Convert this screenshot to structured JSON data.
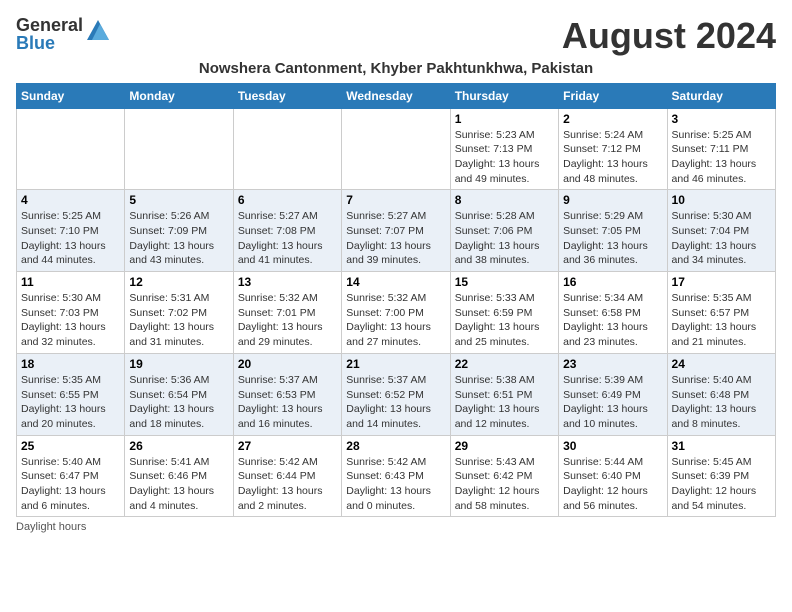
{
  "header": {
    "logo_general": "General",
    "logo_blue": "Blue",
    "month_title": "August 2024",
    "location": "Nowshera Cantonment, Khyber Pakhtunkhwa, Pakistan"
  },
  "weekdays": [
    "Sunday",
    "Monday",
    "Tuesday",
    "Wednesday",
    "Thursday",
    "Friday",
    "Saturday"
  ],
  "weeks": [
    [
      {
        "day": "",
        "info": ""
      },
      {
        "day": "",
        "info": ""
      },
      {
        "day": "",
        "info": ""
      },
      {
        "day": "",
        "info": ""
      },
      {
        "day": "1",
        "info": "Sunrise: 5:23 AM\nSunset: 7:13 PM\nDaylight: 13 hours\nand 49 minutes."
      },
      {
        "day": "2",
        "info": "Sunrise: 5:24 AM\nSunset: 7:12 PM\nDaylight: 13 hours\nand 48 minutes."
      },
      {
        "day": "3",
        "info": "Sunrise: 5:25 AM\nSunset: 7:11 PM\nDaylight: 13 hours\nand 46 minutes."
      }
    ],
    [
      {
        "day": "4",
        "info": "Sunrise: 5:25 AM\nSunset: 7:10 PM\nDaylight: 13 hours\nand 44 minutes."
      },
      {
        "day": "5",
        "info": "Sunrise: 5:26 AM\nSunset: 7:09 PM\nDaylight: 13 hours\nand 43 minutes."
      },
      {
        "day": "6",
        "info": "Sunrise: 5:27 AM\nSunset: 7:08 PM\nDaylight: 13 hours\nand 41 minutes."
      },
      {
        "day": "7",
        "info": "Sunrise: 5:27 AM\nSunset: 7:07 PM\nDaylight: 13 hours\nand 39 minutes."
      },
      {
        "day": "8",
        "info": "Sunrise: 5:28 AM\nSunset: 7:06 PM\nDaylight: 13 hours\nand 38 minutes."
      },
      {
        "day": "9",
        "info": "Sunrise: 5:29 AM\nSunset: 7:05 PM\nDaylight: 13 hours\nand 36 minutes."
      },
      {
        "day": "10",
        "info": "Sunrise: 5:30 AM\nSunset: 7:04 PM\nDaylight: 13 hours\nand 34 minutes."
      }
    ],
    [
      {
        "day": "11",
        "info": "Sunrise: 5:30 AM\nSunset: 7:03 PM\nDaylight: 13 hours\nand 32 minutes."
      },
      {
        "day": "12",
        "info": "Sunrise: 5:31 AM\nSunset: 7:02 PM\nDaylight: 13 hours\nand 31 minutes."
      },
      {
        "day": "13",
        "info": "Sunrise: 5:32 AM\nSunset: 7:01 PM\nDaylight: 13 hours\nand 29 minutes."
      },
      {
        "day": "14",
        "info": "Sunrise: 5:32 AM\nSunset: 7:00 PM\nDaylight: 13 hours\nand 27 minutes."
      },
      {
        "day": "15",
        "info": "Sunrise: 5:33 AM\nSunset: 6:59 PM\nDaylight: 13 hours\nand 25 minutes."
      },
      {
        "day": "16",
        "info": "Sunrise: 5:34 AM\nSunset: 6:58 PM\nDaylight: 13 hours\nand 23 minutes."
      },
      {
        "day": "17",
        "info": "Sunrise: 5:35 AM\nSunset: 6:57 PM\nDaylight: 13 hours\nand 21 minutes."
      }
    ],
    [
      {
        "day": "18",
        "info": "Sunrise: 5:35 AM\nSunset: 6:55 PM\nDaylight: 13 hours\nand 20 minutes."
      },
      {
        "day": "19",
        "info": "Sunrise: 5:36 AM\nSunset: 6:54 PM\nDaylight: 13 hours\nand 18 minutes."
      },
      {
        "day": "20",
        "info": "Sunrise: 5:37 AM\nSunset: 6:53 PM\nDaylight: 13 hours\nand 16 minutes."
      },
      {
        "day": "21",
        "info": "Sunrise: 5:37 AM\nSunset: 6:52 PM\nDaylight: 13 hours\nand 14 minutes."
      },
      {
        "day": "22",
        "info": "Sunrise: 5:38 AM\nSunset: 6:51 PM\nDaylight: 13 hours\nand 12 minutes."
      },
      {
        "day": "23",
        "info": "Sunrise: 5:39 AM\nSunset: 6:49 PM\nDaylight: 13 hours\nand 10 minutes."
      },
      {
        "day": "24",
        "info": "Sunrise: 5:40 AM\nSunset: 6:48 PM\nDaylight: 13 hours\nand 8 minutes."
      }
    ],
    [
      {
        "day": "25",
        "info": "Sunrise: 5:40 AM\nSunset: 6:47 PM\nDaylight: 13 hours\nand 6 minutes."
      },
      {
        "day": "26",
        "info": "Sunrise: 5:41 AM\nSunset: 6:46 PM\nDaylight: 13 hours\nand 4 minutes."
      },
      {
        "day": "27",
        "info": "Sunrise: 5:42 AM\nSunset: 6:44 PM\nDaylight: 13 hours\nand 2 minutes."
      },
      {
        "day": "28",
        "info": "Sunrise: 5:42 AM\nSunset: 6:43 PM\nDaylight: 13 hours\nand 0 minutes."
      },
      {
        "day": "29",
        "info": "Sunrise: 5:43 AM\nSunset: 6:42 PM\nDaylight: 12 hours\nand 58 minutes."
      },
      {
        "day": "30",
        "info": "Sunrise: 5:44 AM\nSunset: 6:40 PM\nDaylight: 12 hours\nand 56 minutes."
      },
      {
        "day": "31",
        "info": "Sunrise: 5:45 AM\nSunset: 6:39 PM\nDaylight: 12 hours\nand 54 minutes."
      }
    ]
  ],
  "footer": {
    "daylight_hours_label": "Daylight hours"
  }
}
